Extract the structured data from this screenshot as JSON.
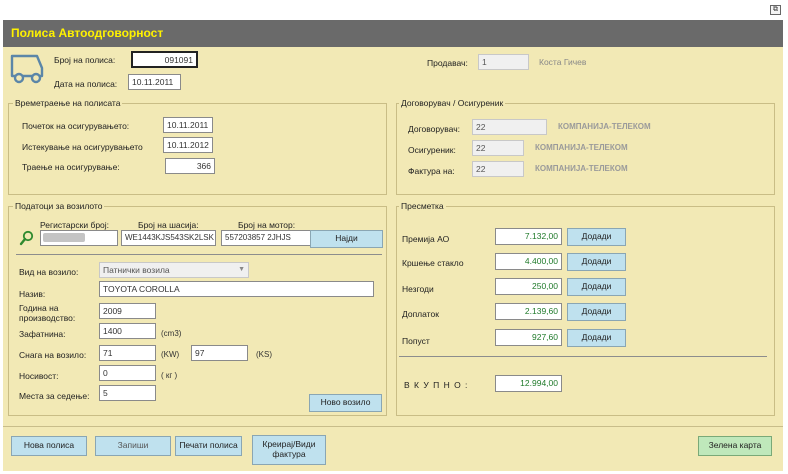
{
  "window": {
    "title": "Полиса Автоодговорност",
    "restore_symbol": "⧉"
  },
  "header": {
    "policy_number_label": "Број на полиса:",
    "policy_number": "091091",
    "policy_date_label": "Дата на полиса:",
    "policy_date": "10.11.2011",
    "seller_label": "Продавач:",
    "seller_code": "1",
    "seller_name": "Коста Гичев"
  },
  "duration": {
    "title": "Времетраење на полисата",
    "start_label": "Почеток на осигурувањето:",
    "start": "10.11.2011",
    "end_label": "Истекување на осигурувањето",
    "end": "10.11.2012",
    "days_label": "Траење на осигурување:",
    "days": "366"
  },
  "contract": {
    "title": "Договорувач / Осигуреник",
    "contractor_label": "Договорувач:",
    "contractor_code": "22",
    "contractor_name": "КОМПАНИЈА-ТЕЛЕКОМ",
    "insured_label": "Осигуреник:",
    "insured_code": "22",
    "insured_name": "КОМПАНИЈА-ТЕЛЕКОМ",
    "invoice_label": "Фактура на:",
    "invoice_code": "22",
    "invoice_name": "КОМПАНИЈА-ТЕЛЕКОМ"
  },
  "vehicle": {
    "title": "Податоци за возилото",
    "reg_label": "Регистарски број:",
    "reg_value": "",
    "chassis_label": "Број на шасија:",
    "chassis_value": "WE1443KJS543SK2LSK",
    "engine_label": "Број на мотор:",
    "engine_value": "557203857 2JHJS",
    "find_button": "Најди",
    "type_label": "Вид на возило:",
    "type_value": "Патнички возила",
    "name_label": "Назив:",
    "name_value": "TOYOTA COROLLA",
    "year_label_1": "Година на",
    "year_label_2": "производство:",
    "year_value": "2009",
    "volume_label": "Зафатнина:",
    "volume_value": "1400",
    "volume_unit": "(cm3)",
    "power_label": "Снага на возило:",
    "power_kw": "71",
    "power_kw_unit": "(KW)",
    "power_ks": "97",
    "power_ks_unit": "(KS)",
    "capacity_label": "Носивост:",
    "capacity_value": "0",
    "capacity_unit": "( кг )",
    "seats_label": "Места за седење:",
    "seats_value": "5",
    "new_vehicle_button": "Ново возило"
  },
  "calculation": {
    "title": "Пресметка",
    "rows": [
      {
        "label": "Премија АО",
        "value": "7.132,00",
        "button": "Додади"
      },
      {
        "label": "Кршење стакло",
        "value": "4.400,00",
        "button": "Додади"
      },
      {
        "label": "Незгоди",
        "value": "250,00",
        "button": "Додади"
      },
      {
        "label": "Доплаток",
        "value": "2.139,60",
        "button": "Додади"
      },
      {
        "label": "Попуст",
        "value": "927,60",
        "button": "Додади"
      }
    ],
    "total_label": "В К У П Н О :",
    "total_value": "12.994,00"
  },
  "footer": {
    "new_policy": "Нова полиса",
    "save": "Запиши",
    "print": "Печати полиса",
    "invoice_1": "Креирај/Види",
    "invoice_2": "фактура",
    "green_card": "Зелена карта"
  },
  "colors": {
    "title_text": "#fff200",
    "form_bg": "#f2e9b5",
    "button_bg": "#bfe1ee",
    "green_button_bg": "#bfe8bb",
    "value_green": "#1f7a2a"
  }
}
